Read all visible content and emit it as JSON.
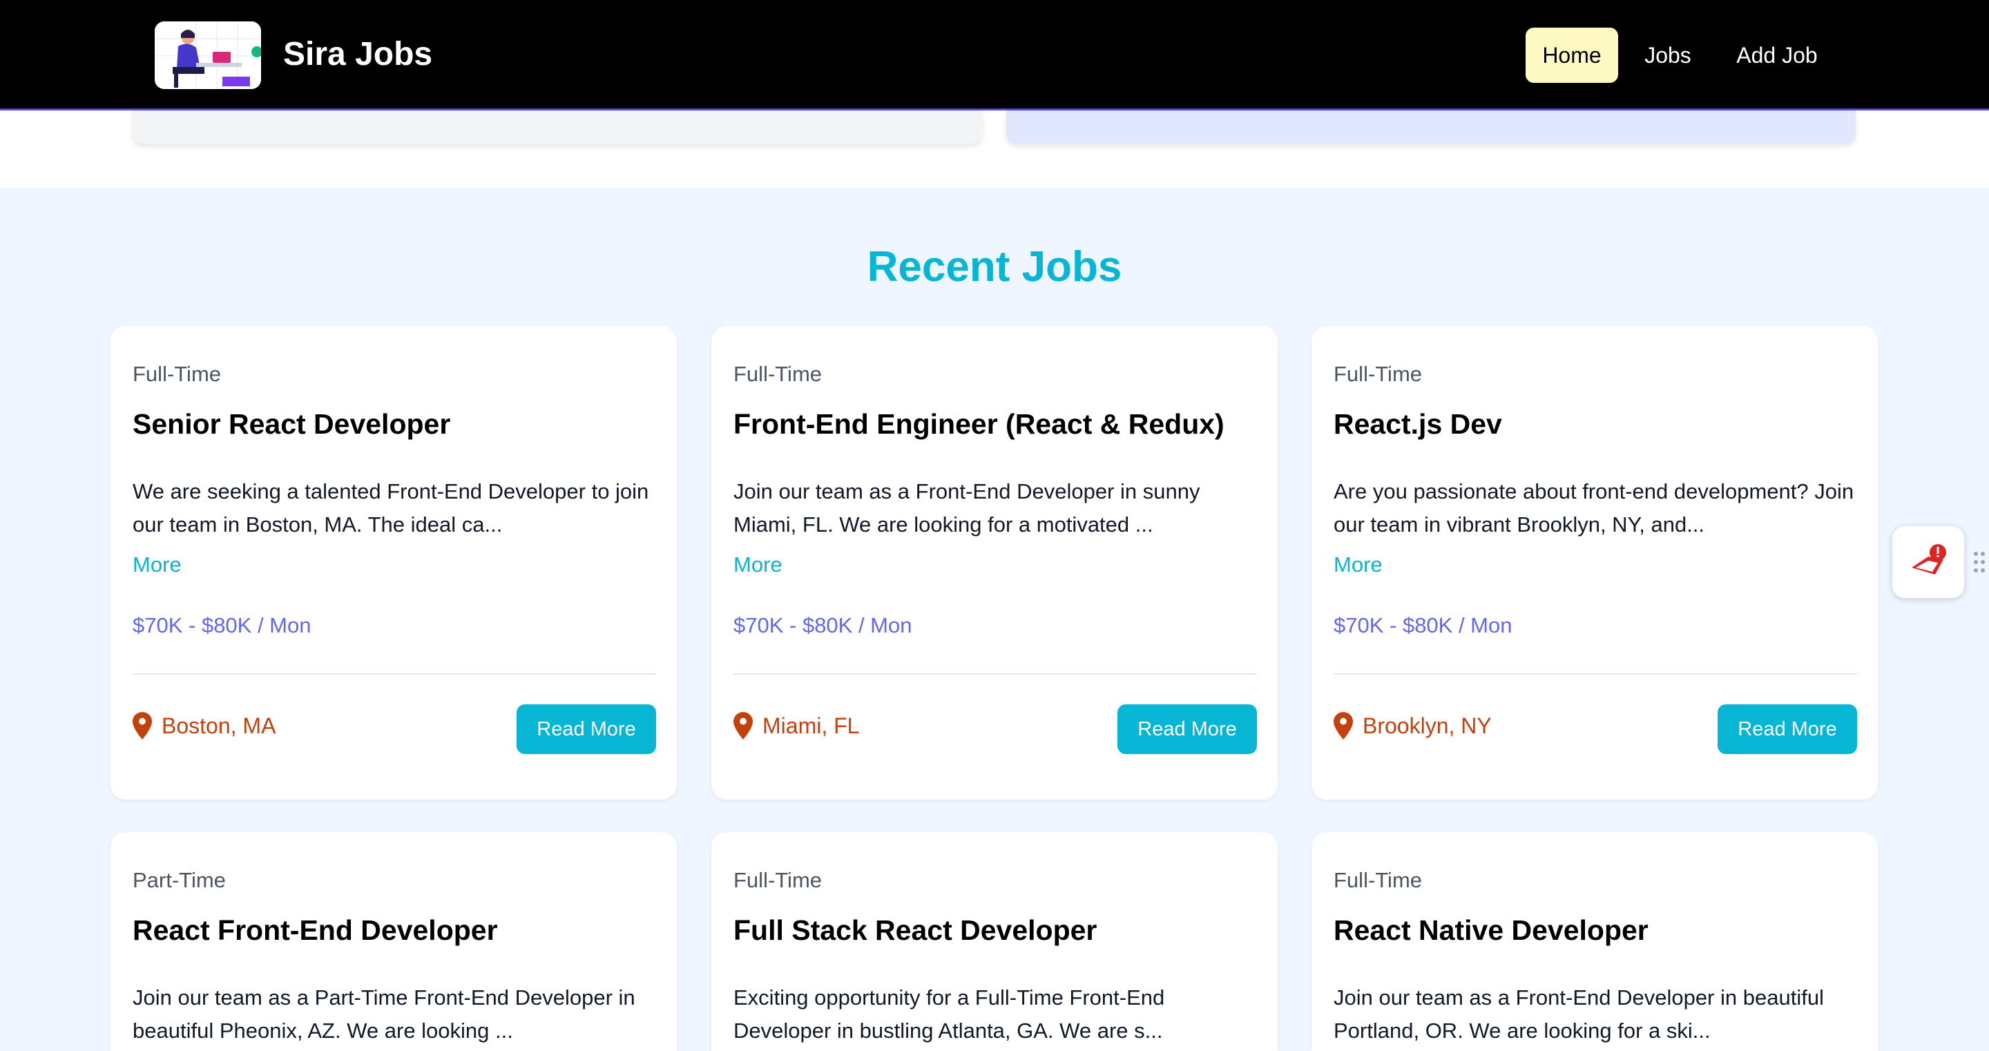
{
  "nav": {
    "brand": "Sira Jobs",
    "links": [
      {
        "label": "Home",
        "active": true
      },
      {
        "label": "Jobs"
      },
      {
        "label": "Add Job"
      }
    ]
  },
  "recent_jobs": {
    "title": "Recent Jobs",
    "more_label": "More",
    "read_more_label": "Read More",
    "jobs": [
      {
        "type": "Full-Time",
        "title": "Senior React Developer",
        "description": "We are seeking a talented Front-End Developer to join our team in Boston, MA. The ideal ca...",
        "salary": "$70K - $80K / Mon",
        "location": "Boston, MA"
      },
      {
        "type": "Full-Time",
        "title": "Front-End Engineer (React & Redux)",
        "description": "Join our team as a Front-End Developer in sunny Miami, FL. We are looking for a motivated ...",
        "salary": "$70K - $80K / Mon",
        "location": "Miami, FL"
      },
      {
        "type": "Full-Time",
        "title": "React.js Dev",
        "description": "Are you passionate about front-end development? Join our team in vibrant Brooklyn, NY, and...",
        "salary": "$70K - $80K / Mon",
        "location": "Brooklyn, NY"
      },
      {
        "type": "Part-Time",
        "title": "React Front-End Developer",
        "description": "Join our team as a Part-Time Front-End Developer in beautiful Pheonix, AZ. We are looking ..."
      },
      {
        "type": "Full-Time",
        "title": "Full Stack React Developer",
        "description": "Exciting opportunity for a Full-Time Front-End Developer in bustling Atlanta, GA. We are s..."
      },
      {
        "type": "Full-Time",
        "title": "React Native Developer",
        "description": "Join our team as a Front-End Developer in beautiful Portland, OR. We are looking for a ski..."
      }
    ]
  },
  "colors": {
    "accent": "#06b6d4",
    "salary": "#6366f1",
    "location": "#c2410c",
    "nav_active_bg": "#fef9c3",
    "section_bg": "#eff6ff"
  },
  "icons": {
    "location": "map-pin-icon",
    "widget": "alert-extension-icon",
    "grip": "drag-handle-icon"
  }
}
